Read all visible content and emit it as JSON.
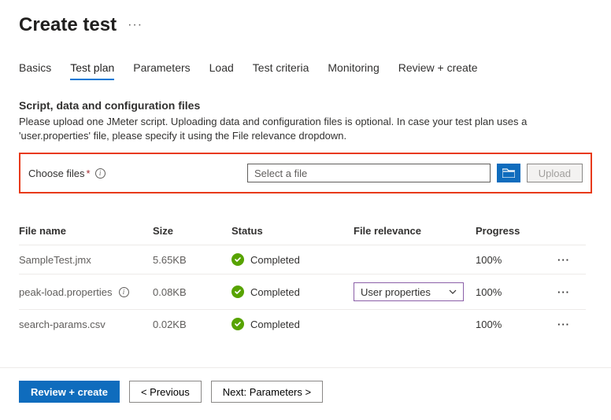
{
  "header": {
    "title": "Create test"
  },
  "tabs": {
    "items": [
      {
        "label": "Basics",
        "active": false
      },
      {
        "label": "Test plan",
        "active": true
      },
      {
        "label": "Parameters",
        "active": false
      },
      {
        "label": "Load",
        "active": false
      },
      {
        "label": "Test criteria",
        "active": false
      },
      {
        "label": "Monitoring",
        "active": false
      },
      {
        "label": "Review + create",
        "active": false
      }
    ]
  },
  "section": {
    "title": "Script, data and configuration files",
    "description": "Please upload one JMeter script. Uploading data and configuration files is optional. In case your test plan uses a 'user.properties' file, please specify it using the File relevance dropdown."
  },
  "choose": {
    "label": "Choose files",
    "required_marker": "*",
    "placeholder": "Select a file",
    "upload_label": "Upload"
  },
  "table": {
    "headers": {
      "name": "File name",
      "size": "Size",
      "status": "Status",
      "relevance": "File relevance",
      "progress": "Progress"
    },
    "rows": [
      {
        "name": "SampleTest.jmx",
        "info": false,
        "size": "5.65KB",
        "status": "Completed",
        "relevance": null,
        "progress": "100%"
      },
      {
        "name": "peak-load.properties",
        "info": true,
        "size": "0.08KB",
        "status": "Completed",
        "relevance": "User properties",
        "progress": "100%"
      },
      {
        "name": "search-params.csv",
        "info": false,
        "size": "0.02KB",
        "status": "Completed",
        "relevance": null,
        "progress": "100%"
      }
    ]
  },
  "footer": {
    "review": "Review + create",
    "previous": "< Previous",
    "next": "Next: Parameters >"
  }
}
